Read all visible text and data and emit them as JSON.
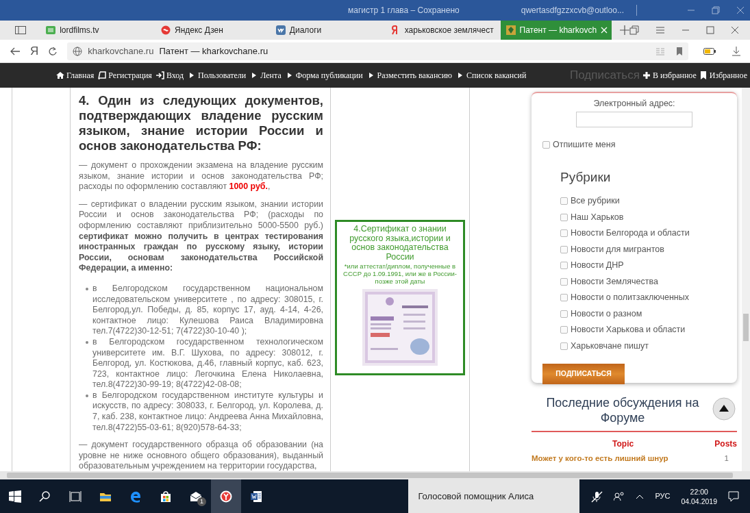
{
  "window": {
    "title": "магистр 1 глава – Сохранено",
    "account": "qwertasdfgzzxcvb@outloo..."
  },
  "tabs": [
    {
      "label": "lordfilms.tv",
      "kind": "hd",
      "selected": false
    },
    {
      "label": "Яндекс Дзен",
      "kind": "zen",
      "selected": false
    },
    {
      "label": "Диалоги",
      "kind": "vk",
      "selected": false
    },
    {
      "label": "харьковское землячест",
      "kind": "yandex",
      "selected": false
    },
    {
      "label": "Патент — kharkovch",
      "kind": "emblem",
      "selected": true
    }
  ],
  "address_bar": {
    "logo": "Я",
    "domain": "kharkovchane.ru",
    "page_title": "Патент — kharkovchane.ru"
  },
  "site_nav": {
    "items": [
      {
        "label": "Главная",
        "kind": "home"
      },
      {
        "label": "Регистрация",
        "kind": "book"
      },
      {
        "label": "Вход",
        "kind": "login"
      },
      {
        "label": "Пользователи",
        "kind": "arrow"
      },
      {
        "label": "Лента",
        "kind": "arrow"
      },
      {
        "label": "Форма публикации",
        "kind": "arrow"
      },
      {
        "label": "Разместить вакансию",
        "kind": "arrow"
      },
      {
        "label": "Список вакансий",
        "kind": "arrow"
      }
    ],
    "covered_heading": "Подписаться",
    "right_items": [
      {
        "label": "В избранное",
        "kind": "plus"
      },
      {
        "label": "Избранное",
        "kind": "bookmark"
      }
    ]
  },
  "article": {
    "blocks": [
      {
        "kind": "heading",
        "text": "4. Один из следующих документов, подтверждающих владение русским языком, знание истории России и основ законодательства РФ:"
      },
      {
        "kind": "paragraph",
        "text": "— документ о прохождении экзамена на владение русским языком, знание истории и основ законодательства РФ; расходы по оформлению составляют **1000 руб.**,"
      },
      {
        "kind": "paragraph",
        "text": "— сертификат о владении русским языком, знании истории России и основ законодательства РФ; (расходы по оформлению составляют приблизительно 5000-5500 руб.) **сертификат можно получить в центрах тестирования иностранных граждан по русскому языку, истории России, основам законодательства Российской Федерации, а именно:**"
      },
      {
        "kind": "list",
        "items": [
          "в Белгородском государственном национальном исследовательском университете , по адресу: 308015, г. Белгород,ул. Победы, д. 85, корпус 17, ауд. 4-14, 4-26, контактное лицо: Кулешова Раиса Владимировна тел.7(4722)30-12-51; 7(4722)30-10-40 );",
          "в Белгородском государственном технологическом университете им. В.Г. Шухова, по адресу: 308012, г. Белгород, ул. Костюкова, д.46, главный корпус, каб. 623, 723, контактное лицо: Легочкина Елена Николаевна, тел.8(4722)30-99-19; 8(4722)42-08-08;",
          "в Белгородском государственном институте культуры и искусств, по адресу: 308033, г. Белгород, ул. Королева, д. 7, каб. 238, контактное лицо: Андреева Анна Михайловна, тел.8(4722)55-03-61; 8(920)578-64-33;"
        ]
      },
      {
        "kind": "paragraph",
        "text": "— документ государственного образца об образовании (на уровне не ниже основного общего образования), выданный образовательным учреждением на территории государства,"
      }
    ]
  },
  "figure": {
    "title": "4.Сертификат о знании русского языка,истории и основ законодательства России",
    "note": "*или аттестат/диплом, полученные в СССР до 1.09.1991, или же в России- позже этой даты"
  },
  "sidebar": {
    "email_label": "Электронный адрес:",
    "unsubscribe": {
      "label": "Отпишите меня",
      "checked": false
    },
    "categories_title": "Рубрики",
    "categories": [
      {
        "label": "Все рубрики",
        "checked": false
      },
      {
        "label": "Наш Харьков",
        "checked": false
      },
      {
        "label": "Новости Белгорода и области",
        "checked": false
      },
      {
        "label": "Новости для мигрантов",
        "checked": false
      },
      {
        "label": "Новости ДНР",
        "checked": false
      },
      {
        "label": "Новости Землячества",
        "checked": false
      },
      {
        "label": "Новости о политзаключенных",
        "checked": false
      },
      {
        "label": "Новости о разном",
        "checked": false
      },
      {
        "label": "Новости Харькова и области",
        "checked": false
      },
      {
        "label": "Харьковчане пишут",
        "checked": false
      }
    ],
    "subscribe_button": "ПОДПИСАТЬСЯ",
    "forum_title": "Последние обсуждения на Форуме",
    "forum_table": {
      "columns": [
        "Topic",
        "Posts"
      ],
      "rows": [
        [
          "Может у кого-то есть лишний шнур",
          "1"
        ]
      ]
    }
  },
  "taskbar": {
    "apps": [
      {
        "kind": "explorer",
        "selected": false
      },
      {
        "kind": "edge",
        "selected": false
      },
      {
        "kind": "store",
        "selected": false
      },
      {
        "kind": "mail",
        "selected": false
      },
      {
        "kind": "yandex",
        "selected": true
      },
      {
        "kind": "word",
        "selected": false
      }
    ],
    "mail_badge": "1",
    "assistant": "Голосовой помощник Алиса",
    "language": "РУС",
    "time": "22:00",
    "date": "04.04.2019"
  }
}
